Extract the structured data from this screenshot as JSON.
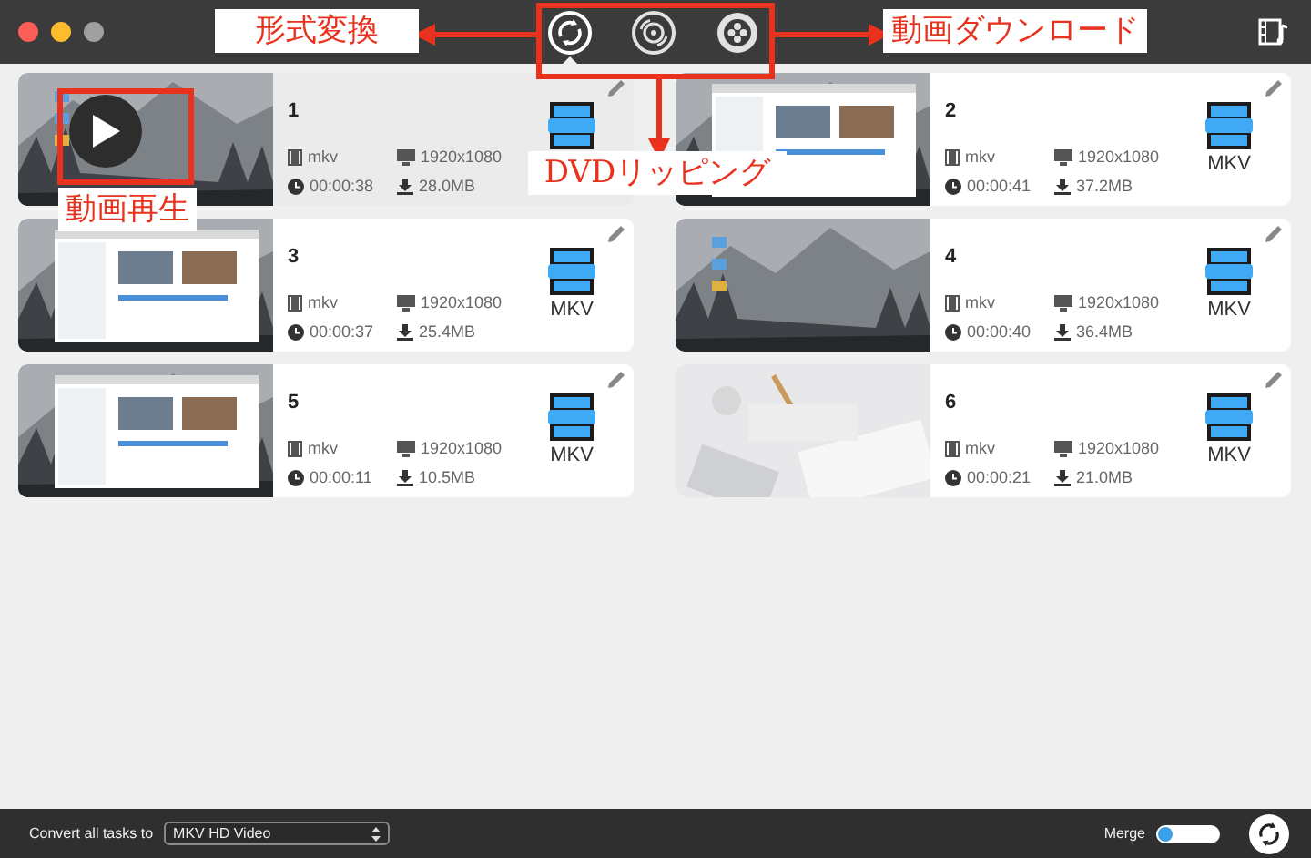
{
  "toolbar": {
    "tabs": [
      {
        "kind": "convert",
        "selected": true
      },
      {
        "kind": "dvd",
        "selected": false
      },
      {
        "kind": "download",
        "selected": false
      }
    ]
  },
  "tasks": [
    {
      "number": "1",
      "selected": true,
      "format": "mkv",
      "resolution": "1920x1080",
      "duration": "00:00:38",
      "size": "28.0MB"
    },
    {
      "number": "2",
      "selected": false,
      "format": "mkv",
      "resolution": "1920x1080",
      "duration": "00:00:41",
      "size": "37.2MB",
      "format_label": "MKV"
    },
    {
      "number": "3",
      "selected": false,
      "format": "mkv",
      "resolution": "1920x1080",
      "duration": "00:00:37",
      "size": "25.4MB",
      "format_label": "MKV"
    },
    {
      "number": "4",
      "selected": false,
      "format": "mkv",
      "resolution": "1920x1080",
      "duration": "00:00:40",
      "size": "36.4MB",
      "format_label": "MKV"
    },
    {
      "number": "5",
      "selected": false,
      "format": "mkv",
      "resolution": "1920x1080",
      "duration": "00:00:11",
      "size": "10.5MB",
      "format_label": "MKV"
    },
    {
      "number": "6",
      "selected": false,
      "format": "mkv",
      "resolution": "1920x1080",
      "duration": "00:00:21",
      "size": "21.0MB",
      "format_label": "MKV"
    }
  ],
  "bottom_bar": {
    "convert_label": "Convert all tasks to",
    "profile": "MKV HD Video",
    "merge_label": "Merge",
    "merge_on": false
  },
  "annotations": [
    {
      "kind": "label",
      "text": "形式変換"
    },
    {
      "kind": "label",
      "text": "動画ダウンロード"
    },
    {
      "kind": "label",
      "text": "DVDリッピング"
    },
    {
      "kind": "label",
      "text": "動画再生"
    },
    {
      "kind": "frame"
    },
    {
      "kind": "frame"
    },
    {
      "kind": "arrow"
    },
    {
      "kind": "arrow"
    },
    {
      "kind": "arrow"
    }
  ]
}
